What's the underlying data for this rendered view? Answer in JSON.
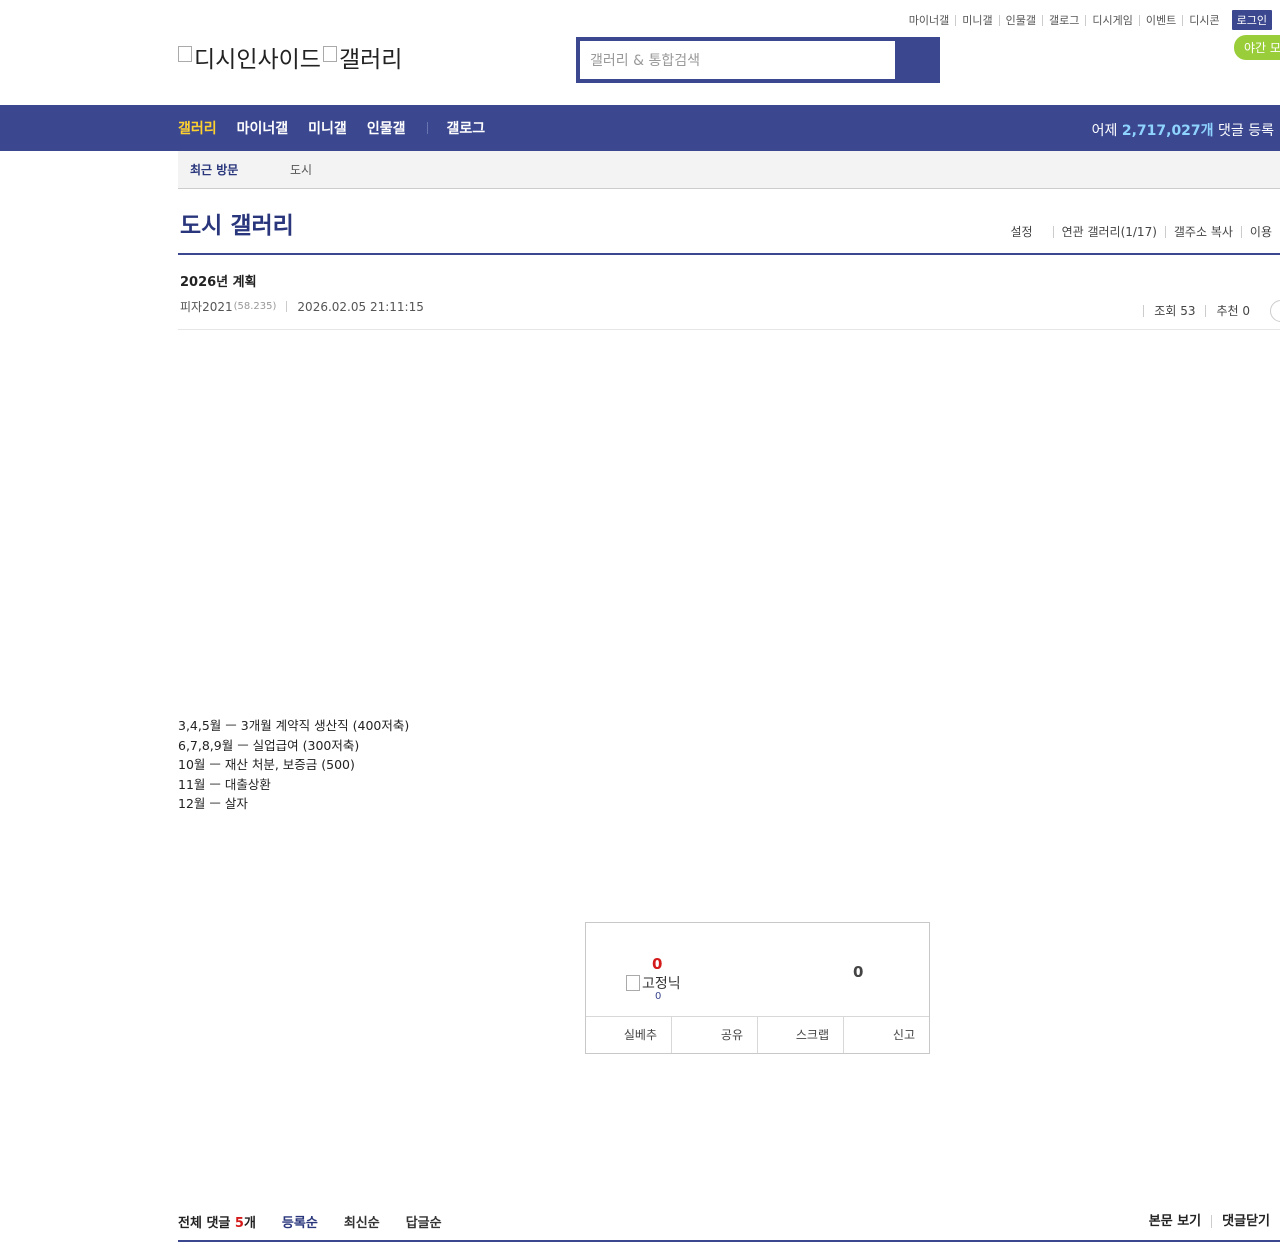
{
  "util_links": [
    "마이너갤",
    "미니갤",
    "인물갤",
    "갤로그",
    "디시게임",
    "이벤트",
    "디시콘"
  ],
  "login_label": "로그인",
  "night_mode_label": "야간 모드",
  "logo": {
    "site": "디시인사이드",
    "section": "갤러리"
  },
  "search": {
    "placeholder": "갤러리 & 통합검색"
  },
  "nav": {
    "items": [
      "갤러리",
      "마이너갤",
      "미니갤",
      "인물갤"
    ],
    "extra": "갤로그",
    "stat_prefix": "어제",
    "stat_count": "2,717,027개",
    "stat_suffix": "댓글 등록"
  },
  "recent": {
    "label": "최근 방문",
    "items": [
      "도시"
    ]
  },
  "gallery": {
    "title": "도시 갤러리",
    "tools": [
      "설정",
      "연관 갤러리(1/17)",
      "갤주소 복사",
      "이용"
    ]
  },
  "post": {
    "title": "2026년 계획",
    "author": "피자2021",
    "ip": "(58.235)",
    "date": "2026.02.05 21:11:15",
    "views_label": "조회 53",
    "recommend_label": "추천 0",
    "lines": [
      "3,4,5월 ㅡ 3개월 계약직 생산직 (400저축)",
      "6,7,8,9월 ㅡ 실업급여 (300저축)",
      "10월 ㅡ 재산 처분, 보증금 (500)",
      "11월 ㅡ 대출상환",
      "12월 ㅡ 살자"
    ]
  },
  "recommend_box": {
    "up_count": "0",
    "fixed_nick_alt": "고정닉",
    "fixed_count": "0",
    "down_count": "0",
    "actions": [
      "실베추",
      "공유",
      "스크랩",
      "신고"
    ]
  },
  "comments": {
    "total_label": "전체 댓글",
    "count": "5",
    "unit": "개",
    "sorts": [
      "등록순",
      "최신순",
      "답글순"
    ],
    "right_links": [
      "본문 보기",
      "댓글닫기"
    ]
  },
  "colors": {
    "brand": "#3b4890",
    "nav_active": "#ffd12e",
    "accent_red": "#d41a1a",
    "night": "#9acd3a"
  }
}
